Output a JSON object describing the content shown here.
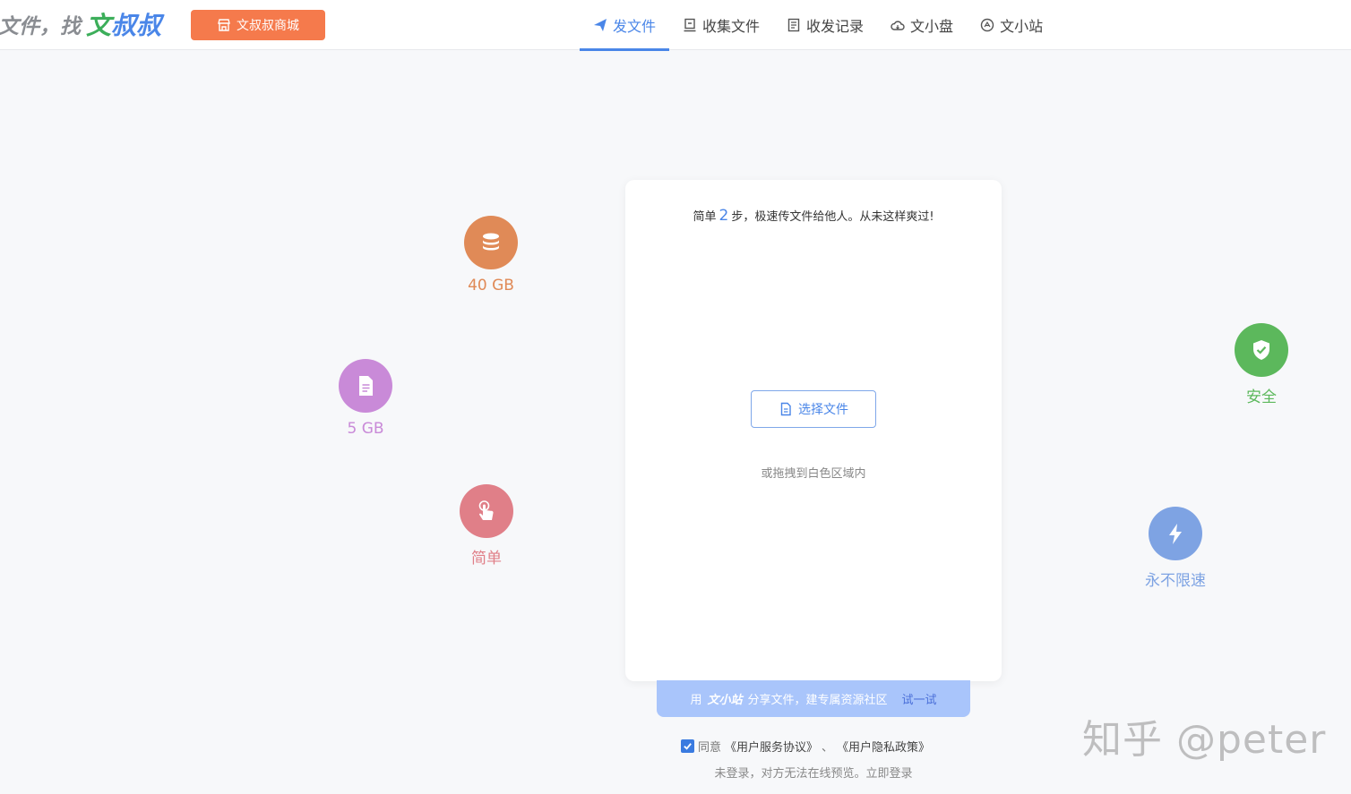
{
  "header": {
    "logo": {
      "part1": "文件，找",
      "part2": "文",
      "part3": "叔叔"
    },
    "shop_button": "文叔叔商城",
    "nav": [
      {
        "label": "发文件",
        "icon": "send-icon"
      },
      {
        "label": "收集文件",
        "icon": "collect-icon"
      },
      {
        "label": "收发记录",
        "icon": "record-icon"
      },
      {
        "label": "文小盘",
        "icon": "cloud-disk-icon"
      },
      {
        "label": "文小站",
        "icon": "station-icon"
      }
    ]
  },
  "features": {
    "storage": {
      "label": "40 GB",
      "color": "#e08a57",
      "icon": "database-icon"
    },
    "file_size": {
      "label": "5 GB",
      "color": "#c98ad8",
      "icon": "file-icon"
    },
    "simple": {
      "label": "简单",
      "color": "#e07f88",
      "icon": "tap-hand-icon"
    },
    "secure": {
      "label": "安全",
      "color": "#5cb85c",
      "icon": "shield-check-icon"
    },
    "speed": {
      "label": "永不限速",
      "color": "#7ea3e3",
      "icon": "lightning-icon"
    }
  },
  "upload_card": {
    "title_prefix": "简单",
    "title_num": "2",
    "title_suffix": "步，极速传文件给他人。从未这样爽过!",
    "select_button": "选择文件",
    "drag_hint": "或拖拽到白色区域内"
  },
  "banner": {
    "prefix": "用",
    "brand": "文小站",
    "text": "分享文件，建专属资源社区",
    "try_link": "试一试"
  },
  "agreement": {
    "agree": "同意",
    "service": "《用户服务协议》",
    "sep": "、",
    "privacy": "《用户隐私政策》",
    "login_hint": "未登录，对方无法在线预览。立即登录"
  },
  "watermark": "知乎 @peter"
}
